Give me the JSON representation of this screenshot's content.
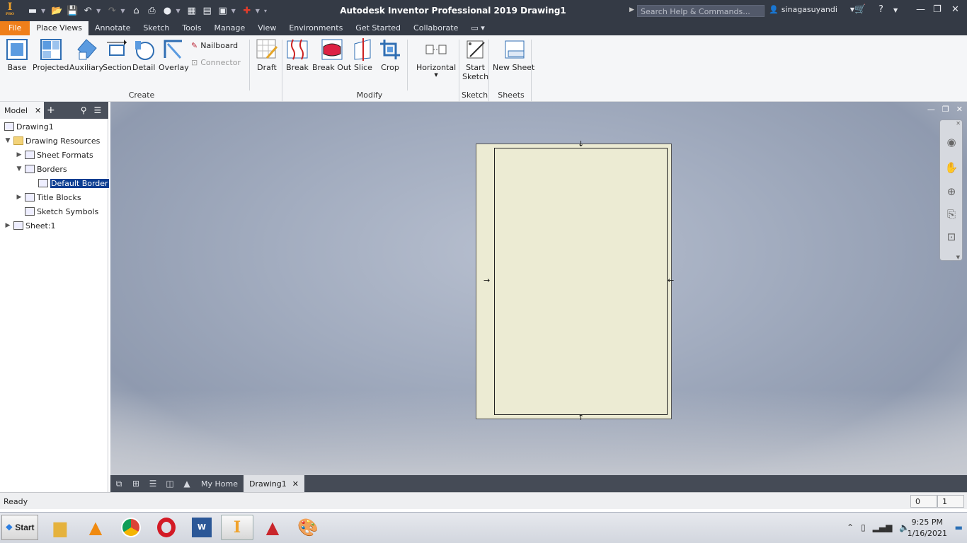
{
  "window": {
    "title": "Autodesk Inventor Professional 2019   Drawing1",
    "app_badge": "PRO",
    "app_letter": "I"
  },
  "search": {
    "placeholder": "Search Help & Commands..."
  },
  "user": {
    "name": "sinagasuyandi"
  },
  "tabs": [
    "File",
    "Place Views",
    "Annotate",
    "Sketch",
    "Tools",
    "Manage",
    "View",
    "Environments",
    "Get Started",
    "Collaborate"
  ],
  "ribbon": {
    "create": {
      "title": "Create",
      "buttons": [
        "Base",
        "Projected",
        "Auxiliary",
        "Section",
        "Detail",
        "Overlay"
      ],
      "small": [
        "Nailboard",
        "Connector"
      ]
    },
    "modify": {
      "title": "Modify",
      "buttons": [
        "Draft",
        "Break",
        "Break Out",
        "Slice",
        "Crop",
        "Horizontal"
      ]
    },
    "sketch": {
      "title": "Sketch",
      "button_line1": "Start",
      "button_line2": "Sketch"
    },
    "sheets": {
      "title": "Sheets",
      "button": "New Sheet"
    }
  },
  "browser": {
    "tab": "Model",
    "items": [
      {
        "label": "Drawing1"
      },
      {
        "label": "Drawing Resources"
      },
      {
        "label": "Sheet Formats"
      },
      {
        "label": "Borders"
      },
      {
        "label": "Default Border"
      },
      {
        "label": "Title Blocks"
      },
      {
        "label": "Sketch Symbols"
      },
      {
        "label": "Sheet:1"
      }
    ]
  },
  "doc_tabs": {
    "home": "My Home",
    "drawing": "Drawing1"
  },
  "status": {
    "text": "Ready",
    "count1": "0",
    "count2": "1"
  },
  "taskbar": {
    "start": "Start",
    "time": "9:25 PM",
    "date": "1/16/2021"
  },
  "colors": {
    "file_tab": "#ef7f1a",
    "titlebar": "#343a45",
    "selection": "#0b3d91",
    "sheet": "#ecebd3"
  }
}
